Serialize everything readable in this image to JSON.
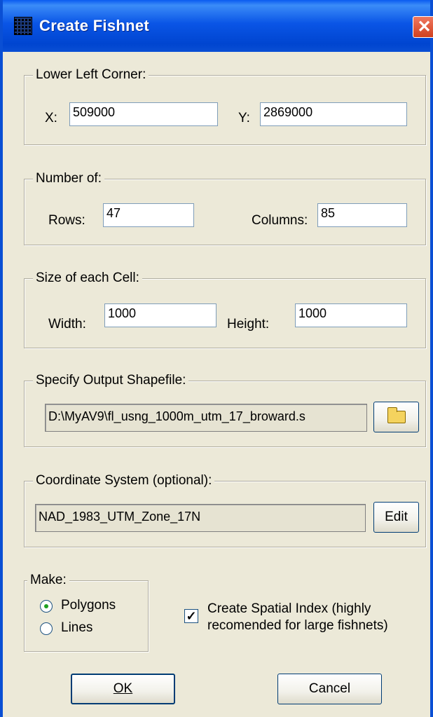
{
  "window": {
    "title": "Create Fishnet"
  },
  "lower_left": {
    "legend": "Lower Left Corner:",
    "x_label": "X:",
    "x_value": "509000",
    "y_label": "Y:",
    "y_value": "2869000"
  },
  "number_of": {
    "legend": "Number of:",
    "rows_label": "Rows:",
    "rows_value": "47",
    "columns_label": "Columns:",
    "columns_value": "85"
  },
  "cell_size": {
    "legend": "Size of each Cell:",
    "width_label": "Width:",
    "width_value": "1000",
    "height_label": "Height:",
    "height_value": "1000"
  },
  "output": {
    "legend": "Specify Output Shapefile:",
    "path": "D:\\MyAV9\\fl_usng_1000m_utm_17_broward.s"
  },
  "coord": {
    "legend": "Coordinate System (optional):",
    "value": "NAD_1983_UTM_Zone_17N",
    "edit_label": "Edit"
  },
  "make": {
    "legend": "Make:",
    "polygons_label": "Polygons",
    "lines_label": "Lines",
    "selected": "Polygons"
  },
  "spatial_index": {
    "label_line1": "Create Spatial Index (highly",
    "label_line2": "recomended for large fishnets)",
    "checked": true
  },
  "buttons": {
    "ok": "OK",
    "cancel": "Cancel"
  }
}
